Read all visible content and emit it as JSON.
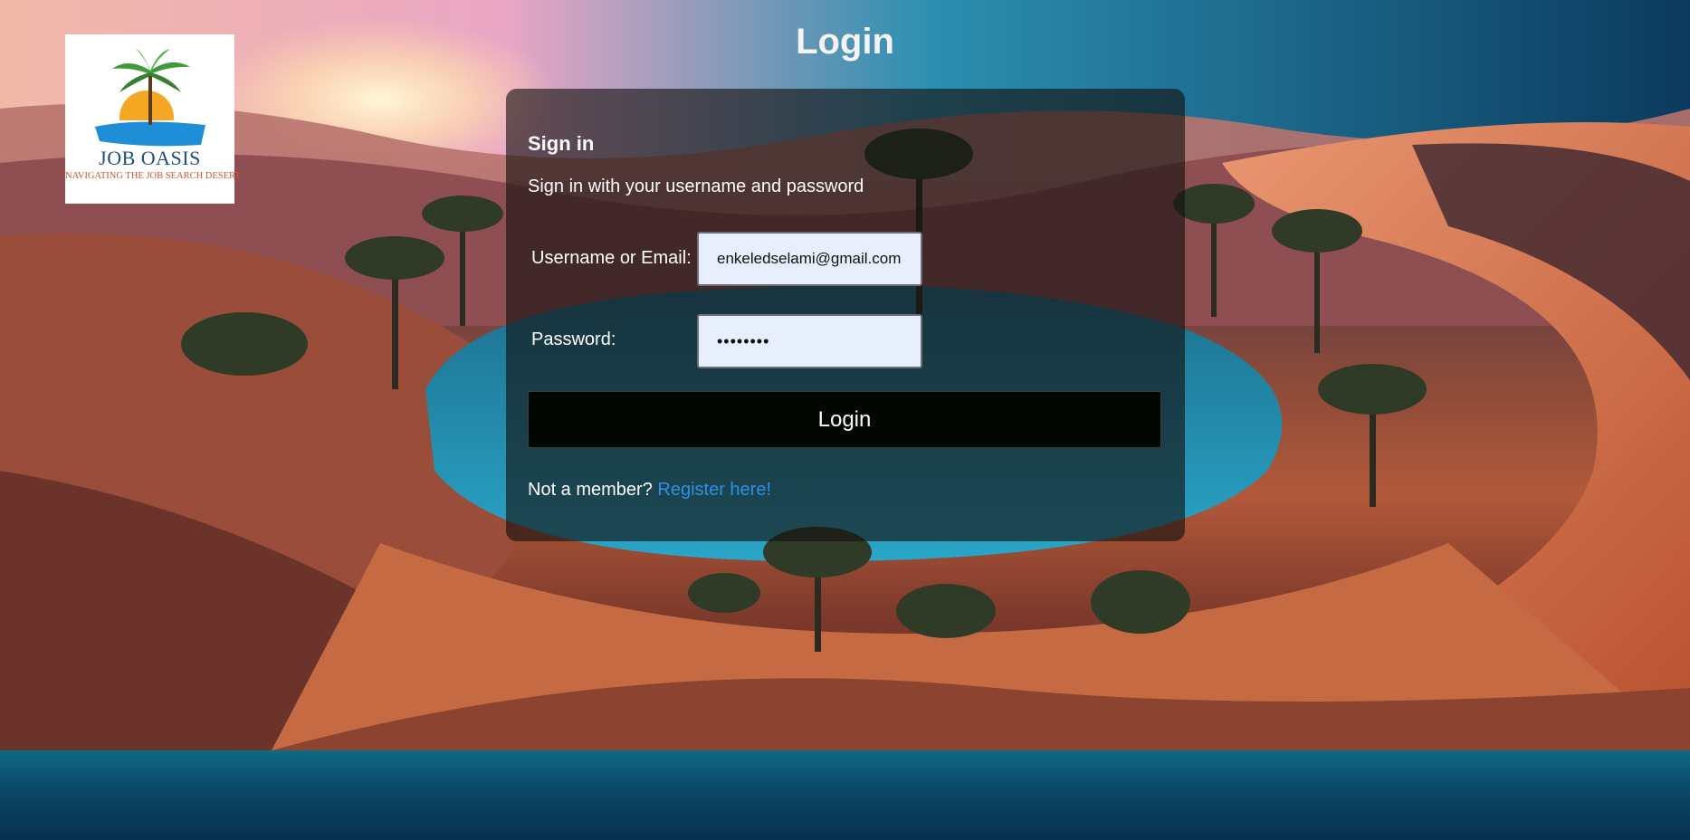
{
  "page": {
    "title": "Login"
  },
  "logo": {
    "title": "JOB OASIS",
    "tagline": "NAVIGATING THE JOB SEARCH DESERT"
  },
  "login_card": {
    "heading": "Sign in",
    "subheading": "Sign in with your username and password",
    "username_label": "Username or Email:",
    "username_value": "enkeledselami@gmail.com",
    "password_label": "Password:",
    "password_value": "••••••••",
    "submit_label": "Login",
    "register_prompt": "Not a member?",
    "register_link": "Register here!"
  },
  "colors": {
    "card_background": "rgba(20,16,14,0.62)",
    "input_background": "#e8effc",
    "button_background": "#020702",
    "link": "#2f8fe6",
    "title_text": "#f4f4f4"
  }
}
